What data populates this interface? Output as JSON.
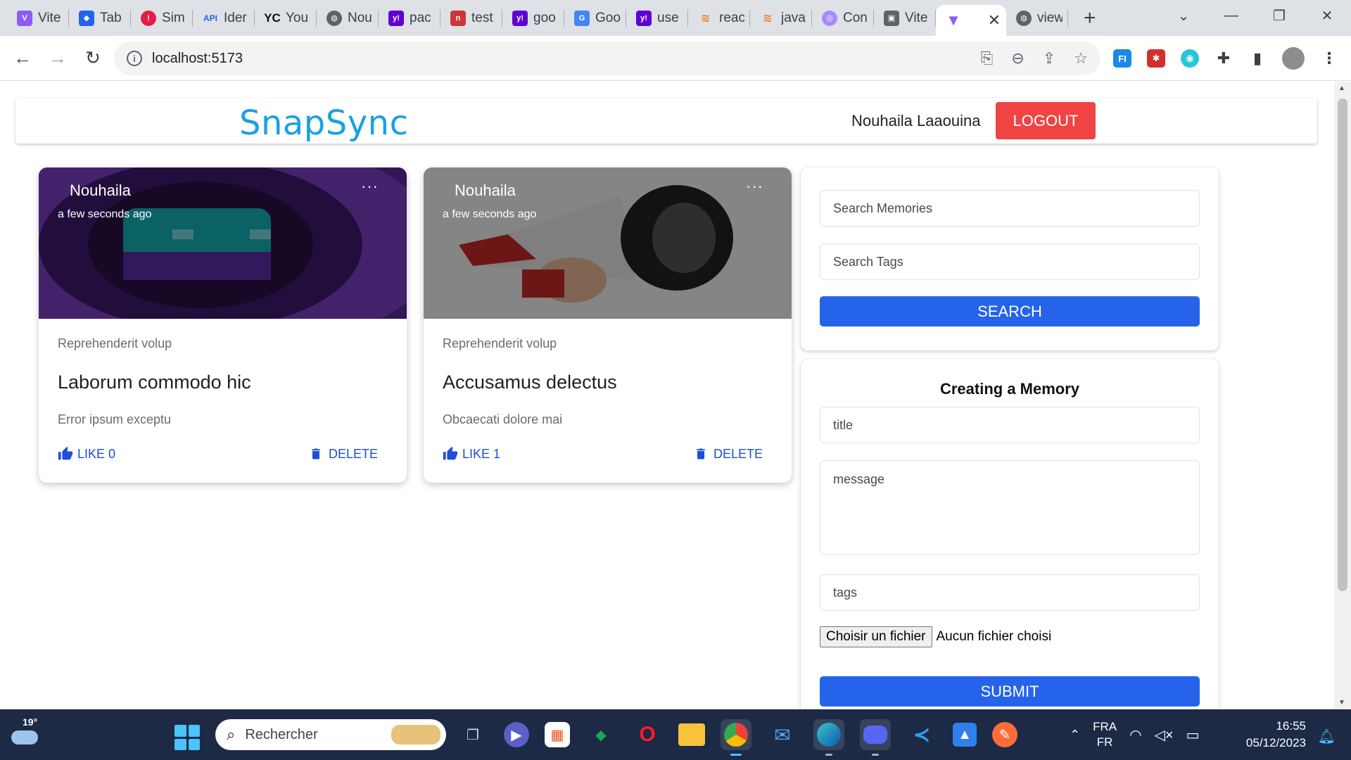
{
  "browser": {
    "tabs": [
      {
        "title": "Vite",
        "icon": "vite-icon",
        "color": "#8b5cf6"
      },
      {
        "title": "Tab",
        "icon": "diamond-icon",
        "color": "#2563eb"
      },
      {
        "title": "Sim",
        "icon": "target-icon",
        "color": "#e11d48"
      },
      {
        "title": "Ider",
        "icon": "api-icon",
        "color": "#2563eb"
      },
      {
        "title": "You",
        "icon": "yc-icon",
        "color": "#111111"
      },
      {
        "title": "Nou",
        "icon": "globe-icon",
        "color": "#5f6368"
      },
      {
        "title": "pac",
        "icon": "yahoo-icon",
        "color": "#6001d2"
      },
      {
        "title": "test",
        "icon": "npm-icon",
        "color": "#cb3837"
      },
      {
        "title": "goo",
        "icon": "yahoo-icon",
        "color": "#6001d2"
      },
      {
        "title": "Goo",
        "icon": "translate-icon",
        "color": "#4285f4"
      },
      {
        "title": "use",
        "icon": "yahoo-icon",
        "color": "#6001d2"
      },
      {
        "title": "reac",
        "icon": "stackoverflow-icon",
        "color": "#f48024"
      },
      {
        "title": "java",
        "icon": "stackoverflow-icon",
        "color": "#f48024"
      },
      {
        "title": "Con",
        "icon": "cone-icon",
        "color": "#a78bfa"
      },
      {
        "title": "Vite",
        "icon": "folder-icon",
        "color": "#5f6368"
      }
    ],
    "active_tab": {
      "icon": "vite-icon",
      "color": "#8b5cf6"
    },
    "last_tab": {
      "title": "view",
      "icon": "globe-icon"
    },
    "url": "localhost:5173"
  },
  "app": {
    "brand": "SnapSync",
    "brand_color": "#1ba0e2",
    "username": "Nouhaila Laaouina",
    "logout_label": "LOGOUT",
    "logout_color": "#ef4444"
  },
  "posts": [
    {
      "creator": "Nouhaila",
      "time": "a few seconds ago",
      "more": "···",
      "tags": "Reprehenderit volup",
      "title": "Laborum commodo hic",
      "message": "Error ipsum exceptu",
      "like_label": "LIKE 0",
      "delete_label": "DELETE",
      "image": "pixel-art-portal"
    },
    {
      "creator": "Nouhaila",
      "time": "a few seconds ago",
      "more": "···",
      "tags": "Reprehenderit volup",
      "title": "Accusamus delectus",
      "message": "Obcaecati dolore mai",
      "like_label": "LIKE 1",
      "delete_label": "DELETE",
      "image": "megaphone"
    }
  ],
  "search": {
    "memories_placeholder": "Search Memories",
    "tags_placeholder": "Search Tags",
    "button_label": "SEARCH"
  },
  "create": {
    "heading": "Creating a Memory",
    "title_placeholder": "title",
    "message_placeholder": "message",
    "tags_placeholder": "tags",
    "file_button": "Choisir un fichier",
    "file_status": "Aucun fichier choisi",
    "submit_label": "SUBMIT"
  },
  "accent": "#2563eb",
  "taskbar": {
    "temperature": "19°",
    "search_placeholder": "Rechercher",
    "lang_top": "FRA",
    "lang_bottom": "FR",
    "time": "16:55",
    "date": "05/12/2023"
  }
}
